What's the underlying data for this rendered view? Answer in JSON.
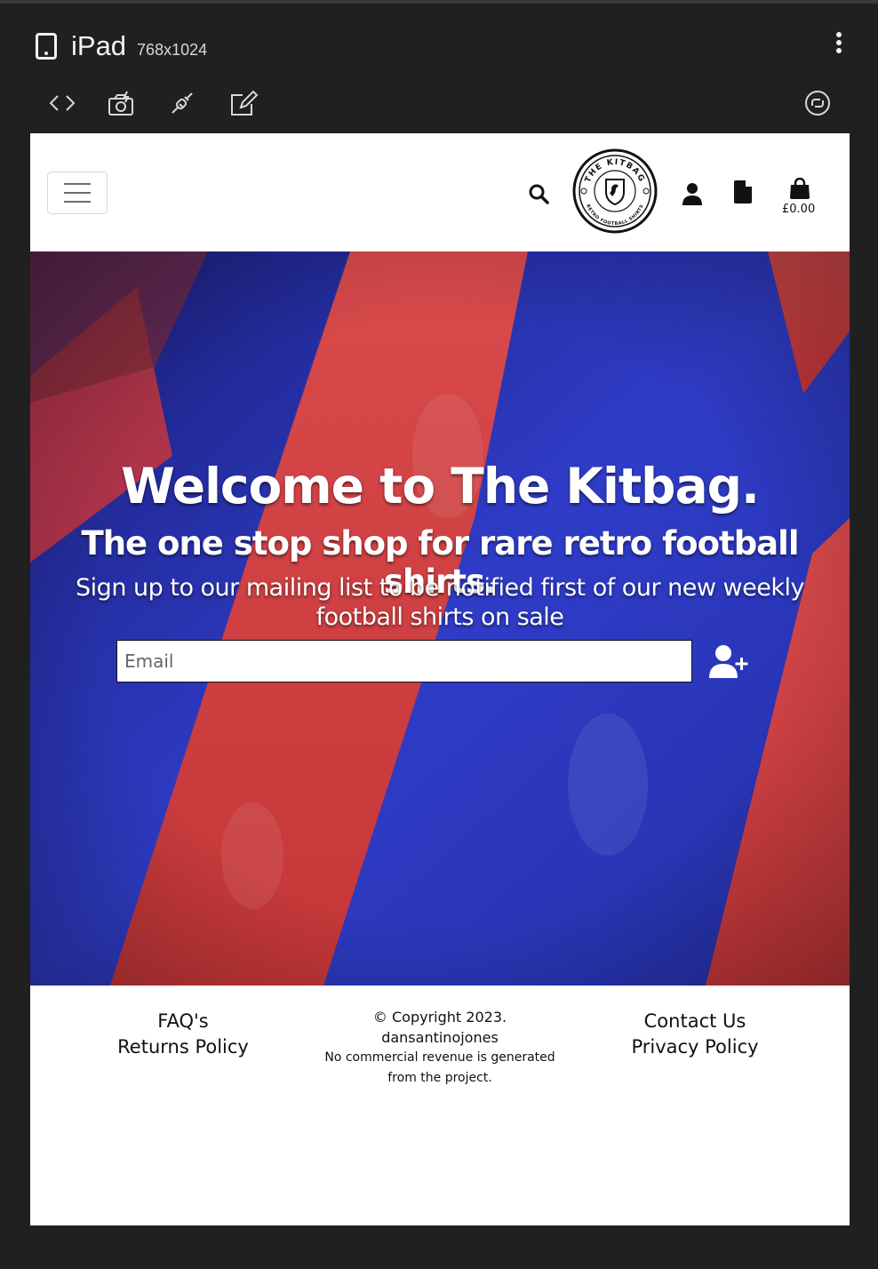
{
  "devtools": {
    "device_name": "iPad",
    "device_size": "768x1024",
    "icons": [
      "code-icon",
      "screenshot-icon",
      "plug-icon",
      "edit-icon",
      "rotate-icon",
      "more-vert-icon"
    ]
  },
  "navbar": {
    "logo_text_top": "THE KITBAG",
    "logo_text_bottom": "RETRO FOOTBALL SHIRTS",
    "bag_total": "£0.00",
    "icons": [
      "menu-toggle-icon",
      "search-icon",
      "account-icon",
      "document-icon",
      "shopping-bag-icon"
    ]
  },
  "hero": {
    "title": "Welcome to The Kitbag.",
    "subtitle": "The one stop shop for rare retro football shirts.",
    "cta": "Sign up to our mailing list to be notified first of our new weekly football shirts on sale",
    "email_placeholder": "Email",
    "email_value": "",
    "subscribe_icon": "user-plus-icon"
  },
  "footer": {
    "left_links": [
      "FAQ's",
      "Returns Policy"
    ],
    "copyright": "© Copyright 2023.",
    "author": "dansantinojones",
    "disclaimer_line1": "No commercial revenue is generated",
    "disclaimer_line2": "from the project.",
    "right_links": [
      "Contact Us",
      "Privacy Policy"
    ]
  },
  "colors": {
    "chrome_bg": "#202020",
    "hero_blue": "#2a33b6",
    "hero_red": "#d43a3f",
    "text_dark": "#111111"
  }
}
